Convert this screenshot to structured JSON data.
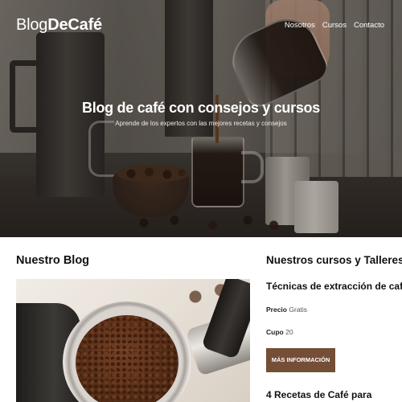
{
  "header": {
    "logo_light": "Blog",
    "logo_bold": "DeCafé",
    "nav": [
      "Nosotros",
      "Cursos",
      "Contacto"
    ]
  },
  "hero": {
    "title": "Blog de café con consejos y cursos",
    "subtitle": "Aprende de los expertos con las mejores recetas y consejos"
  },
  "blog": {
    "title": "Nuestro Blog"
  },
  "courses": {
    "title": "Nuestros cursos y Talleres",
    "items": [
      {
        "title": "Técnicas de extracción de café",
        "price_label": "Precio",
        "price_value": "Gratis",
        "cupo_label": "Cupo",
        "cupo_value": "20",
        "button": "MÁS INFORMACIÓN"
      },
      {
        "title": "4 Recetas de Café para"
      }
    ]
  },
  "colors": {
    "button": "#754e37",
    "text": "#111111"
  }
}
